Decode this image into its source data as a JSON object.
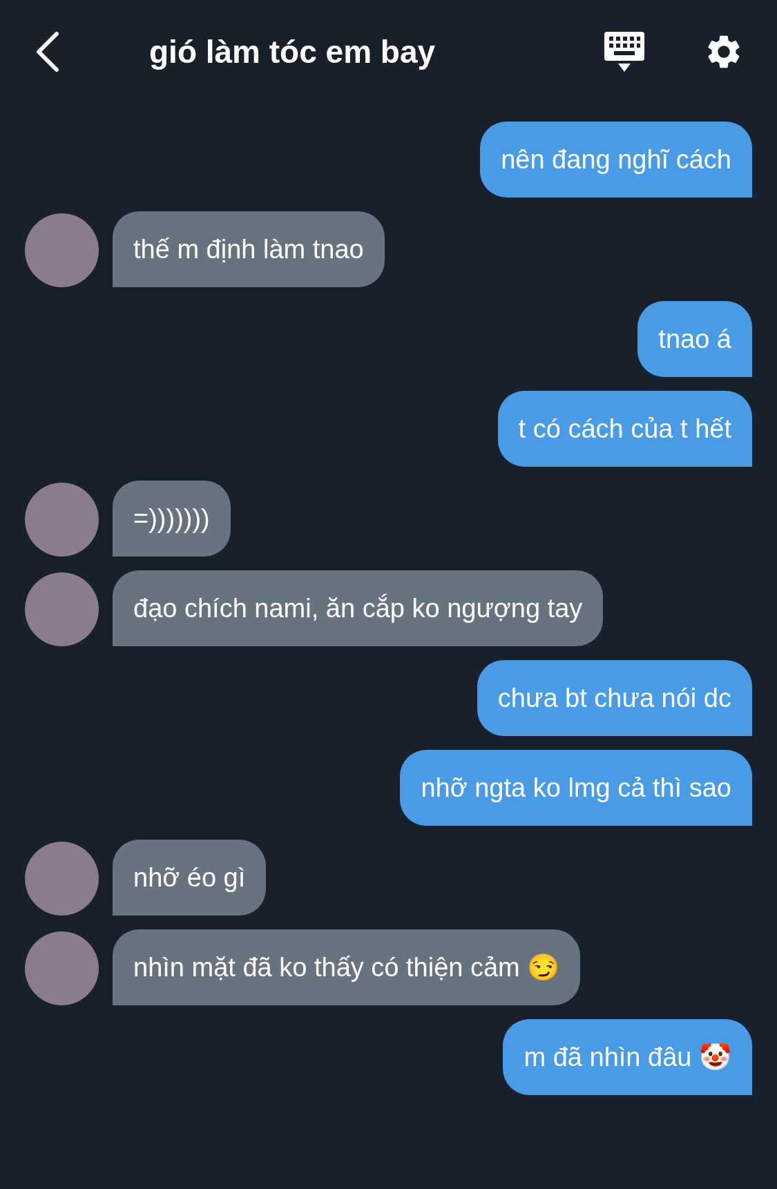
{
  "header": {
    "title": "gió làm tóc em bay"
  },
  "messages": [
    {
      "kind": "sent",
      "text": "nên đang nghĩ cách"
    },
    {
      "kind": "received",
      "text": "thế m định làm tnao"
    },
    {
      "kind": "sent",
      "text": "tnao á"
    },
    {
      "kind": "sent",
      "text": "t có cách của t hết"
    },
    {
      "kind": "received",
      "text": "=)))))))"
    },
    {
      "kind": "received",
      "text": "đạo chích nami, ăn cắp ko ngượng tay"
    },
    {
      "kind": "sent",
      "text": "chưa bt chưa nói dc"
    },
    {
      "kind": "sent",
      "text": "nhỡ ngta ko lmg cả thì sao"
    },
    {
      "kind": "received",
      "text": "nhỡ éo gì"
    },
    {
      "kind": "received",
      "text": "nhìn mặt đã ko thấy có thiện cảm 😏"
    },
    {
      "kind": "sent",
      "text": "m đã nhìn đâu 🤡"
    }
  ]
}
